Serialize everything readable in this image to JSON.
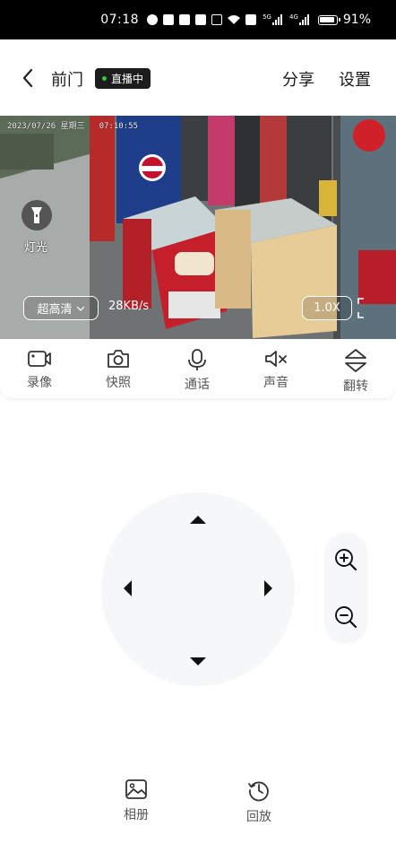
{
  "status_bar": {
    "time": "07:18",
    "network_5g": "5G",
    "network_4g": "4G",
    "battery": "91%"
  },
  "header": {
    "title": "前门",
    "live_badge": "直播中",
    "share": "分享",
    "settings": "设置"
  },
  "video": {
    "osd_date": "2023/07/26 星期三",
    "osd_time": "07:10:55",
    "light_label": "灯光",
    "quality": "超高清",
    "speed": "28KB/s",
    "zoom": "1.0X"
  },
  "toolbar": {
    "items": [
      {
        "label": "录像",
        "icon": "video-record-icon"
      },
      {
        "label": "快照",
        "icon": "camera-icon"
      },
      {
        "label": "通话",
        "icon": "microphone-icon"
      },
      {
        "label": "声音",
        "icon": "speaker-muted-icon"
      },
      {
        "label": "翻转",
        "icon": "flip-icon"
      }
    ]
  },
  "ptz": {
    "directions": [
      "up",
      "down",
      "left",
      "right"
    ]
  },
  "zoom_controls": {
    "in": "zoom-in-icon",
    "out": "zoom-out-icon"
  },
  "bottom": {
    "album": "相册",
    "playback": "回放"
  },
  "colors": {
    "live_dot": "#2ecc40",
    "badge_bg": "#1c1c1c",
    "panel_bg": "#f6f7f9"
  }
}
